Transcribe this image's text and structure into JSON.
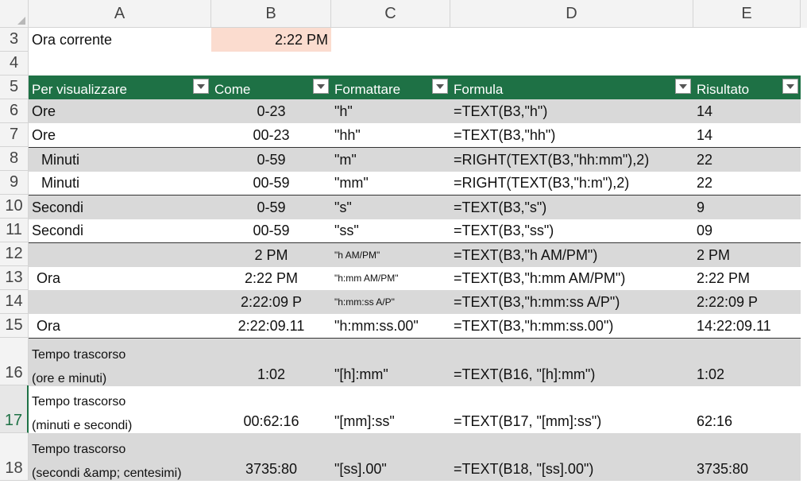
{
  "columns": [
    "A",
    "B",
    "C",
    "D",
    "E"
  ],
  "rows": {
    "r3": {
      "num": "3",
      "label": "Ora corrente",
      "value": "2:22 PM"
    },
    "r4": {
      "num": "4"
    },
    "r5": {
      "num": "5",
      "h1": "Per visualizzare",
      "h2": "Come",
      "h3": "Formattare",
      "h4": "Formula",
      "h5": "Risultato"
    },
    "r6": {
      "num": "6",
      "a": "Ore",
      "b": "0-23",
      "c": "\"h\"",
      "d": "=TEXT(B3,\"h\")",
      "e": "14"
    },
    "r7": {
      "num": "7",
      "a": "Ore",
      "b": "00-23",
      "c": "\"hh\"",
      "d": "=TEXT(B3,\"hh\")",
      "e": "14"
    },
    "r8": {
      "num": "8",
      "a": "Minuti",
      "b": "0-59",
      "c": "\"m\"",
      "d": "=RIGHT(TEXT(B3,\"hh:mm\"),2)",
      "e": "22"
    },
    "r9": {
      "num": "9",
      "a": "Minuti",
      "b": "00-59",
      "c": "\"mm\"",
      "d": "=RIGHT(TEXT(B3,\"h:m\"),2)",
      "e": "22"
    },
    "r10": {
      "num": "10",
      "a": "Secondi",
      "b": "0-59",
      "c": "\"s\"",
      "d": "=TEXT(B3,\"s\")",
      "e": "9"
    },
    "r11": {
      "num": "11",
      "a": "Secondi",
      "b": "00-59",
      "c": "\"ss\"",
      "d": "=TEXT(B3,\"ss\")",
      "e": "09"
    },
    "r12": {
      "num": "12",
      "a": "",
      "b": "2 PM",
      "c": "\"h AM/PM\"",
      "d": "=TEXT(B3,\"h AM/PM\")",
      "e": "2 PM"
    },
    "r13": {
      "num": "13",
      "a": "Ora",
      "b": "2:22 PM",
      "c": "\"h:mm AM/PM\"",
      "d": "=TEXT(B3,\"h:mm AM/PM\")",
      "e": "2:22 PM"
    },
    "r14": {
      "num": "14",
      "a": "",
      "b": "2:22:09 P",
      "c": "\"h:mm:ss A/P\"",
      "d": "=TEXT(B3,\"h:mm:ss A/P\")",
      "e": "2:22:09 P"
    },
    "r15": {
      "num": "15",
      "a": "Ora",
      "b": "2:22:09.11",
      "c": "\"h:mm:ss.00\"",
      "d": "=TEXT(B3,\"h:mm:ss.00\")",
      "e": "14:22:09.11"
    },
    "r16": {
      "num": "16",
      "a1": "Tempo trascorso",
      "a2": "(ore e minuti)",
      "b": "1:02",
      "c": "\"[h]:mm\"",
      "d": "=TEXT(B16, \"[h]:mm\")",
      "e": "1:02"
    },
    "r17": {
      "num": "17",
      "a1": "Tempo trascorso",
      "a2": "(minuti e secondi)",
      "b": "00:62:16",
      "c": "\"[mm]:ss\"",
      "d": "=TEXT(B17, \"[mm]:ss\")",
      "e": "62:16"
    },
    "r18": {
      "num": "18",
      "a1": "Tempo trascorso",
      "a2": "(secondi &amp; centesimi)",
      "b": "3735:80",
      "c": "\"[ss].00\"",
      "d": "=TEXT(B18, \"[ss].00\")",
      "e": "3735:80"
    }
  }
}
